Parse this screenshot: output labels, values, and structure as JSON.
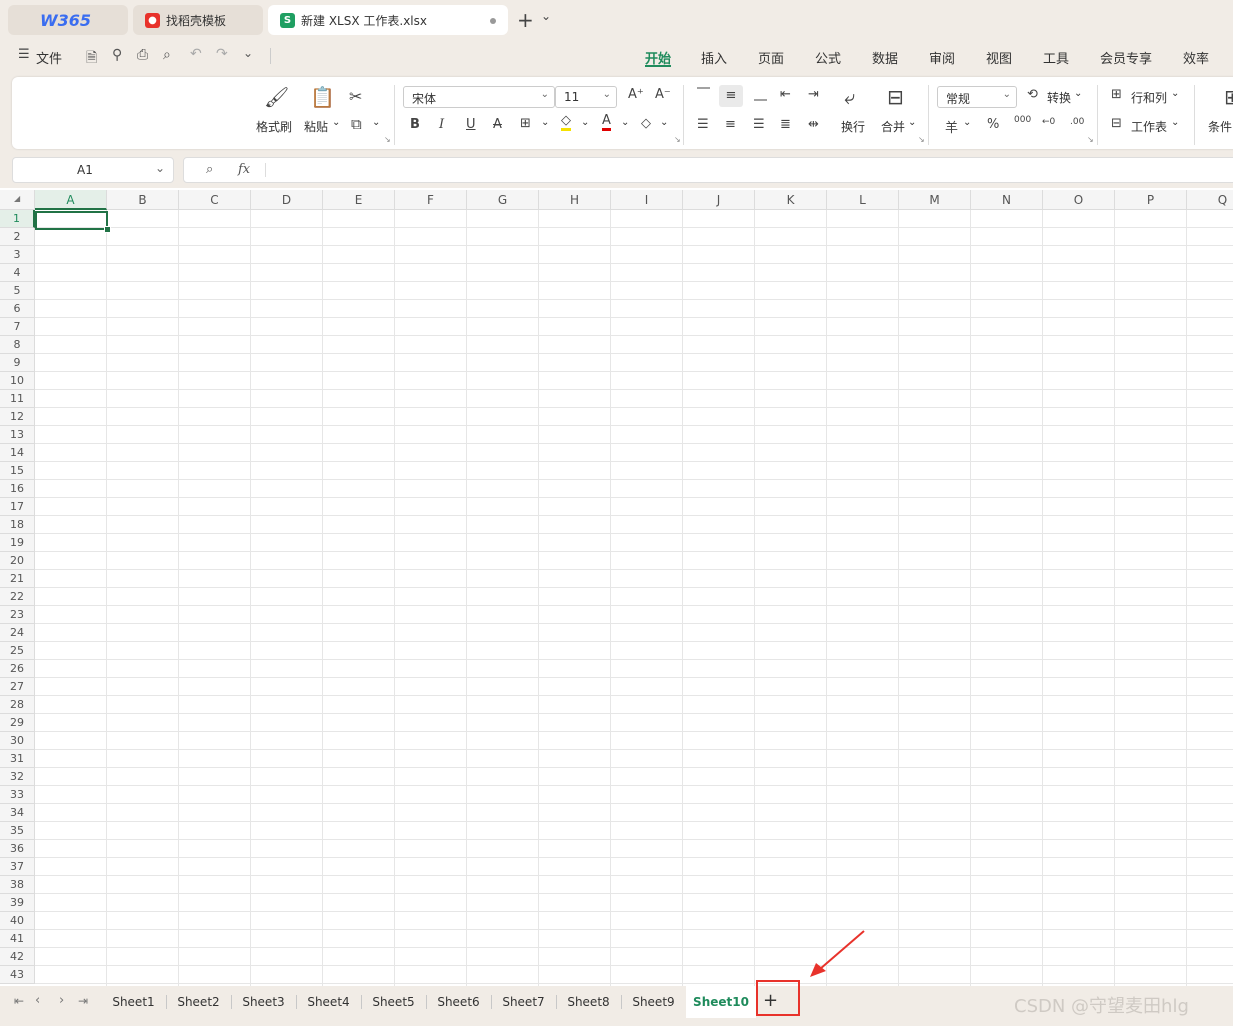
{
  "tabs": {
    "logo": "W365",
    "template_tab": "找稻壳模板",
    "doc_tab": "新建 XLSX 工作表.xlsx",
    "doc_icon_letter": "S",
    "new_tab_plus": "+",
    "new_tab_caret": "⌄"
  },
  "menu": {
    "file_label": "文件",
    "tabs": [
      "开始",
      "插入",
      "页面",
      "公式",
      "数据",
      "审阅",
      "视图",
      "工具",
      "会员专享",
      "效率"
    ]
  },
  "ribbon": {
    "format_painter": "格式刷",
    "paste": "粘贴",
    "font_name": "宋体",
    "font_size": "11",
    "wrap": "换行",
    "merge": "合并",
    "number_format": "常规",
    "convert": "转换",
    "rows_cols": "行和列",
    "worksheet": "工作表",
    "conditional": "条件",
    "bold": "B",
    "italic": "I",
    "underline": "U",
    "strike": "A",
    "currency": "羊",
    "percent": "%",
    "thousands": "000",
    "dec_inc": "←0",
    "dec_dec": ".00",
    "font_inc": "A⁺",
    "font_dec": "A⁻"
  },
  "formula": {
    "cell_ref": "A1",
    "fx": "fx",
    "value": ""
  },
  "grid": {
    "columns": [
      "A",
      "B",
      "C",
      "D",
      "E",
      "F",
      "G",
      "H",
      "I",
      "J",
      "K",
      "L",
      "M",
      "N",
      "O",
      "P",
      "Q"
    ],
    "rows": [
      "1",
      "2",
      "3",
      "4",
      "5",
      "6",
      "7",
      "8",
      "9",
      "10",
      "11",
      "12",
      "13",
      "14",
      "15",
      "16",
      "17",
      "18",
      "19",
      "20",
      "21",
      "22",
      "23",
      "24",
      "25",
      "26",
      "27",
      "28",
      "29",
      "30",
      "31",
      "32",
      "33",
      "34",
      "35",
      "36",
      "37",
      "38",
      "39",
      "40",
      "41",
      "42",
      "43"
    ],
    "active_cell": "A1"
  },
  "sheets": {
    "names": [
      "Sheet1",
      "Sheet2",
      "Sheet3",
      "Sheet4",
      "Sheet5",
      "Sheet6",
      "Sheet7",
      "Sheet8",
      "Sheet9",
      "Sheet10"
    ],
    "active": "Sheet10",
    "add_label": "+"
  },
  "watermark": "CSDN @守望麦田hlg",
  "colors": {
    "accent": "#1f8b5c",
    "annotation": "#e8322b",
    "selection": "#217346"
  }
}
